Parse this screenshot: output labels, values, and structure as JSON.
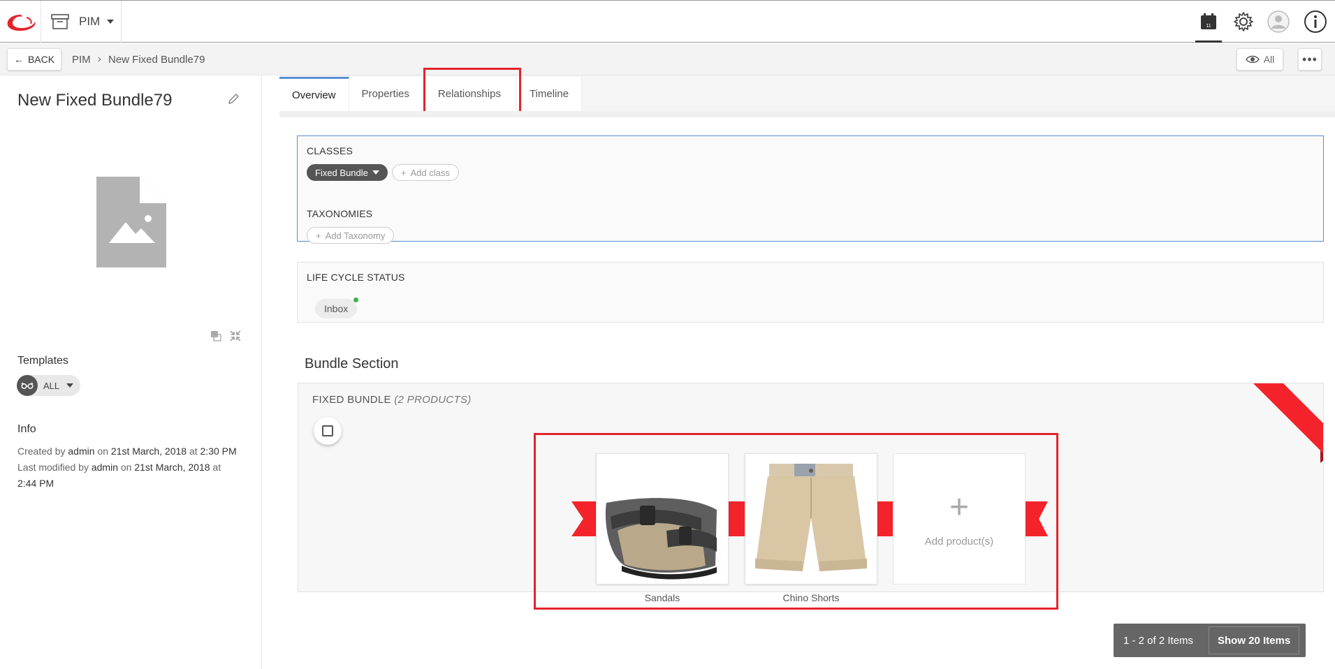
{
  "topbar": {
    "app_label": "PIM",
    "icons": [
      "logo-icon",
      "archive-icon",
      "calendar-icon",
      "gear-icon",
      "user-icon",
      "info-icon"
    ],
    "calendar_badge": "11"
  },
  "subbar": {
    "back_label": "BACK",
    "breadcrumb": [
      "PIM",
      "New Fixed Bundle79"
    ],
    "view_label": "All",
    "more_label": "•••"
  },
  "entity": {
    "title": "New Fixed Bundle79",
    "templates_label": "Templates",
    "templates_value": "ALL",
    "info_label": "Info",
    "created_by_prefix": "Created by",
    "created_by": "admin",
    "created_on_prefix": "on",
    "created_date": "21st March, 2018",
    "created_at_prefix": "at",
    "created_time": "2:30 PM",
    "modified_prefix": "Last modified by",
    "modified_by": "admin",
    "modified_on_prefix": "on",
    "modified_date": "21st March, 2018",
    "modified_at_prefix": "at",
    "modified_time": "2:44 PM"
  },
  "tabs": [
    {
      "label": "Overview",
      "active": true
    },
    {
      "label": "Properties",
      "active": false
    },
    {
      "label": "Relationships",
      "active": false
    },
    {
      "label": "Timeline",
      "active": false
    }
  ],
  "classes": {
    "heading": "CLASSES",
    "chip": "Fixed Bundle",
    "add_label": "Add class"
  },
  "taxonomies": {
    "heading": "TAXONOMIES",
    "add_label": "Add Taxonomy"
  },
  "lifecycle": {
    "heading": "LIFE CYCLE STATUS",
    "status": "Inbox",
    "status_color": "#3cb44b"
  },
  "bundle": {
    "section_title": "Bundle Section",
    "heading": "FIXED BUNDLE",
    "count_label": "(2 PRODUCTS)",
    "products": [
      {
        "name": "Sandals"
      },
      {
        "name": "Chino Shorts"
      }
    ],
    "add_label": "Add product(s)",
    "pager_range": "1 - 2 of 2 Items",
    "pager_size": "Show 20 Items"
  },
  "colors": {
    "accent_red": "#e3242b",
    "tab_active": "#5b8fd3",
    "ribbon": "#f4232b"
  }
}
